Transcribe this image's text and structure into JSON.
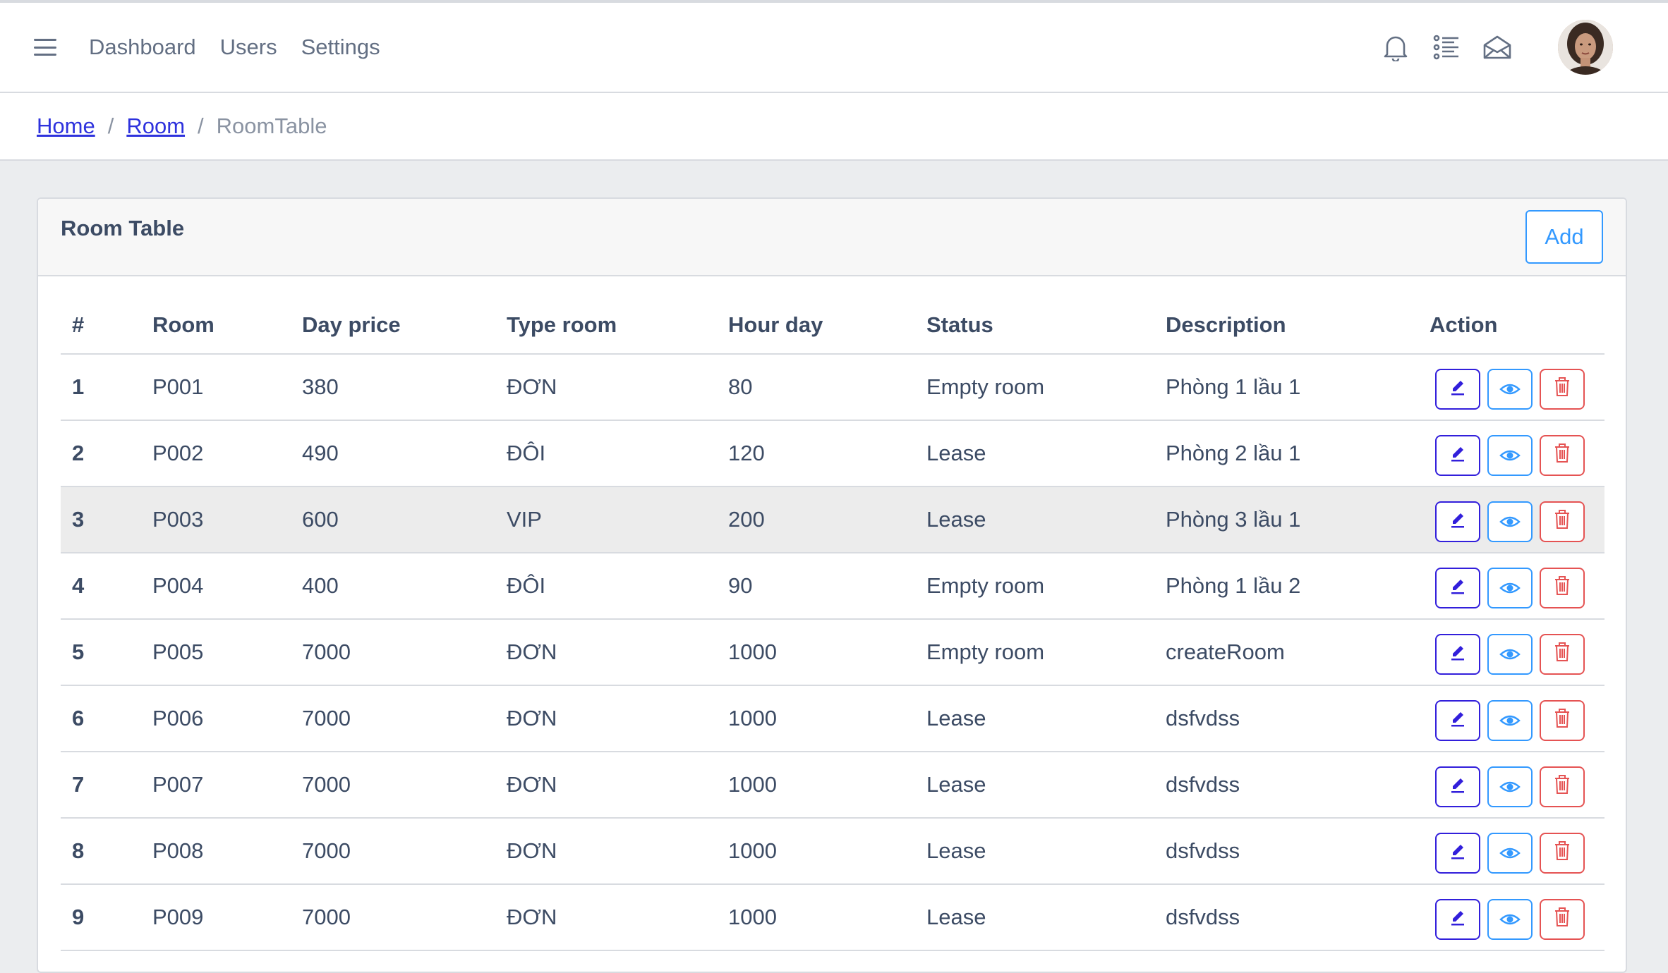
{
  "header": {
    "nav": [
      "Dashboard",
      "Users",
      "Settings"
    ]
  },
  "breadcrumb": {
    "home": "Home",
    "room": "Room",
    "current": "RoomTable",
    "separator": "/"
  },
  "card": {
    "title": "Room Table",
    "add_label": "Add"
  },
  "table": {
    "columns": [
      "#",
      "Room",
      "Day price",
      "Type room",
      "Hour day",
      "Status",
      "Description",
      "Action"
    ],
    "rows": [
      {
        "num": "1",
        "room": "P001",
        "price": "380",
        "type": "ĐƠN",
        "hours": "80",
        "status": "Empty room",
        "desc": "Phòng 1 lầu 1"
      },
      {
        "num": "2",
        "room": "P002",
        "price": "490",
        "type": "ĐÔI",
        "hours": "120",
        "status": "Lease",
        "desc": "Phòng 2 lầu 1"
      },
      {
        "num": "3",
        "room": "P003",
        "price": "600",
        "type": "VIP",
        "hours": "200",
        "status": "Lease",
        "desc": "Phòng 3 lầu 1"
      },
      {
        "num": "4",
        "room": "P004",
        "price": "400",
        "type": "ĐÔI",
        "hours": "90",
        "status": "Empty room",
        "desc": "Phòng 1 lầu 2"
      },
      {
        "num": "5",
        "room": "P005",
        "price": "7000",
        "type": "ĐƠN",
        "hours": "1000",
        "status": "Empty room",
        "desc": "createRoom"
      },
      {
        "num": "6",
        "room": "P006",
        "price": "7000",
        "type": "ĐƠN",
        "hours": "1000",
        "status": "Lease",
        "desc": "dsfvdss"
      },
      {
        "num": "7",
        "room": "P007",
        "price": "7000",
        "type": "ĐƠN",
        "hours": "1000",
        "status": "Lease",
        "desc": "dsfvdss"
      },
      {
        "num": "8",
        "room": "P008",
        "price": "7000",
        "type": "ĐƠN",
        "hours": "1000",
        "status": "Lease",
        "desc": "dsfvdss"
      },
      {
        "num": "9",
        "room": "P009",
        "price": "7000",
        "type": "ĐƠN",
        "hours": "1000",
        "status": "Lease",
        "desc": "dsfvdss"
      }
    ]
  },
  "colors": {
    "edit": "#321fdb",
    "view": "#3399ff",
    "delete": "#e55353"
  },
  "icons": {
    "menu": "hamburger-icon",
    "bell": "bell-icon",
    "list": "list-icon",
    "mail": "envelope-icon",
    "edit": "pencil-icon",
    "view": "eye-icon",
    "delete": "trash-icon"
  }
}
